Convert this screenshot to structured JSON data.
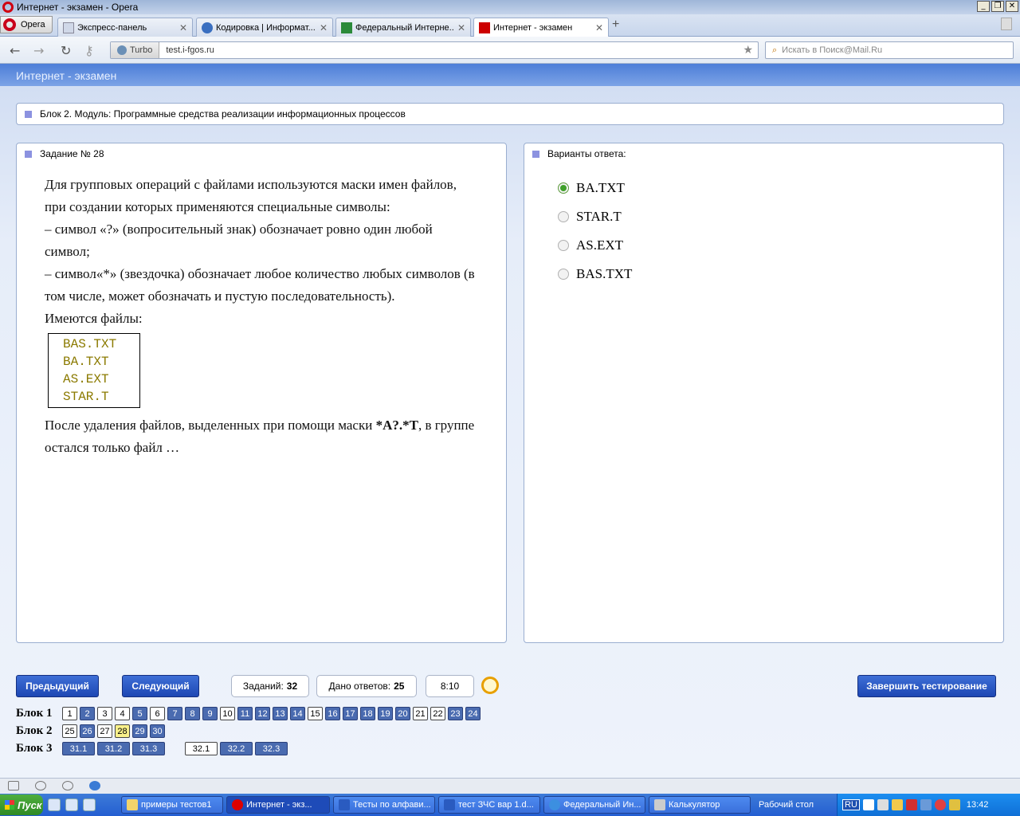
{
  "window": {
    "title": "Интернет - экзамен - Opera",
    "controls": [
      "_",
      "❐",
      "✕"
    ]
  },
  "browser": {
    "opera_label": "Opera",
    "tabs": [
      {
        "label": "Экспресс-панель",
        "close": "✕"
      },
      {
        "label": "Кодировка | Информат...",
        "close": "✕"
      },
      {
        "label": "Федеральный Интерне...",
        "close": "✕"
      },
      {
        "label": "Интернет - экзамен",
        "close": "✕"
      }
    ],
    "new_tab": "+",
    "turbo": "Turbo",
    "url": "test.i-fgos.ru",
    "search_placeholder": "Искать в Поиск@Mail.Ru"
  },
  "page": {
    "header": "Интернет - экзамен",
    "block_title": "Блок 2. Модуль: Программные средства реализации информационных процессов",
    "task_title": "Задание № 28",
    "question": {
      "p1": "Для групповых операций с файлами используются маски имен файлов, при создании которых применяются специальные символы:",
      "p2": "– символ «?» (вопросительный знак) обозначает ровно один любой символ;",
      "p3": "– символ«*» (звездочка) обозначает любое количество любых символов (в том числе, может обозначать и пустую последовательность).",
      "p4": "Имеются файлы:",
      "files": [
        "BAS.TXT",
        "BA.TXT",
        "AS.EXT",
        "STAR.T"
      ],
      "p5_pre": "После удаления файлов, выделенных при помощи маски ",
      "p5_mask": "*A?.*T",
      "p5_mid": ", в группе остался только файл ",
      "p5_post": "…"
    },
    "answers_title": "Варианты ответа:",
    "answers": [
      {
        "label": "BA.TXT",
        "selected": true
      },
      {
        "label": "STAR.T",
        "selected": false
      },
      {
        "label": "AS.EXT",
        "selected": false
      },
      {
        "label": "BAS.TXT",
        "selected": false
      }
    ],
    "controls": {
      "prev": "Предыдущий",
      "next": "Следующий",
      "tasks_label": "Заданий:",
      "tasks_value": "32",
      "answered_label": "Дано ответов:",
      "answered_value": "25",
      "timer": "8:10",
      "finish": "Завершить тестирование"
    },
    "nav": {
      "block1_label": "Блок 1",
      "block1": [
        {
          "n": "1",
          "state": "white"
        },
        {
          "n": "2",
          "state": "blue"
        },
        {
          "n": "3",
          "state": "white"
        },
        {
          "n": "4",
          "state": "white"
        },
        {
          "n": "5",
          "state": "blue"
        },
        {
          "n": "6",
          "state": "white"
        },
        {
          "n": "7",
          "state": "blue"
        },
        {
          "n": "8",
          "state": "blue"
        },
        {
          "n": "9",
          "state": "blue"
        },
        {
          "n": "10",
          "state": "white"
        },
        {
          "n": "11",
          "state": "blue"
        },
        {
          "n": "12",
          "state": "blue"
        },
        {
          "n": "13",
          "state": "blue"
        },
        {
          "n": "14",
          "state": "blue"
        },
        {
          "n": "15",
          "state": "white"
        },
        {
          "n": "16",
          "state": "blue"
        },
        {
          "n": "17",
          "state": "blue"
        },
        {
          "n": "18",
          "state": "blue"
        },
        {
          "n": "19",
          "state": "blue"
        },
        {
          "n": "20",
          "state": "blue"
        },
        {
          "n": "21",
          "state": "white"
        },
        {
          "n": "22",
          "state": "white"
        },
        {
          "n": "23",
          "state": "blue"
        },
        {
          "n": "24",
          "state": "blue"
        }
      ],
      "block2_label": "Блок 2",
      "block2": [
        {
          "n": "25",
          "state": "white"
        },
        {
          "n": "26",
          "state": "blue"
        },
        {
          "n": "27",
          "state": "white"
        },
        {
          "n": "28",
          "state": "yellow"
        },
        {
          "n": "29",
          "state": "blue"
        },
        {
          "n": "30",
          "state": "blue"
        }
      ],
      "block3_label": "Блок 3",
      "block3": [
        {
          "n": "31.1",
          "state": "blue"
        },
        {
          "n": "31.2",
          "state": "blue"
        },
        {
          "n": "31.3",
          "state": "blue"
        },
        {
          "n": "32.1",
          "state": "white"
        },
        {
          "n": "32.2",
          "state": "blue"
        },
        {
          "n": "32.3",
          "state": "blue"
        }
      ]
    }
  },
  "taskbar": {
    "start": "Пуск",
    "tasks": [
      {
        "label": "примеры тестов1",
        "active": false
      },
      {
        "label": "Интернет - экз...",
        "active": true
      },
      {
        "label": "Тесты по алфави...",
        "active": false
      },
      {
        "label": "тест ЗЧС вар 1.d...",
        "active": false
      },
      {
        "label": "Федеральный Ин...",
        "active": false
      },
      {
        "label": "Калькулятор",
        "active": false
      }
    ],
    "desktop": "Рабочий стол",
    "lang": "RU",
    "time": "13:42"
  },
  "colors": {
    "header": "#4d7ed8",
    "button": "#1d47b4",
    "selected_radio": "#3fa02a",
    "file_text": "#8b7a00"
  }
}
